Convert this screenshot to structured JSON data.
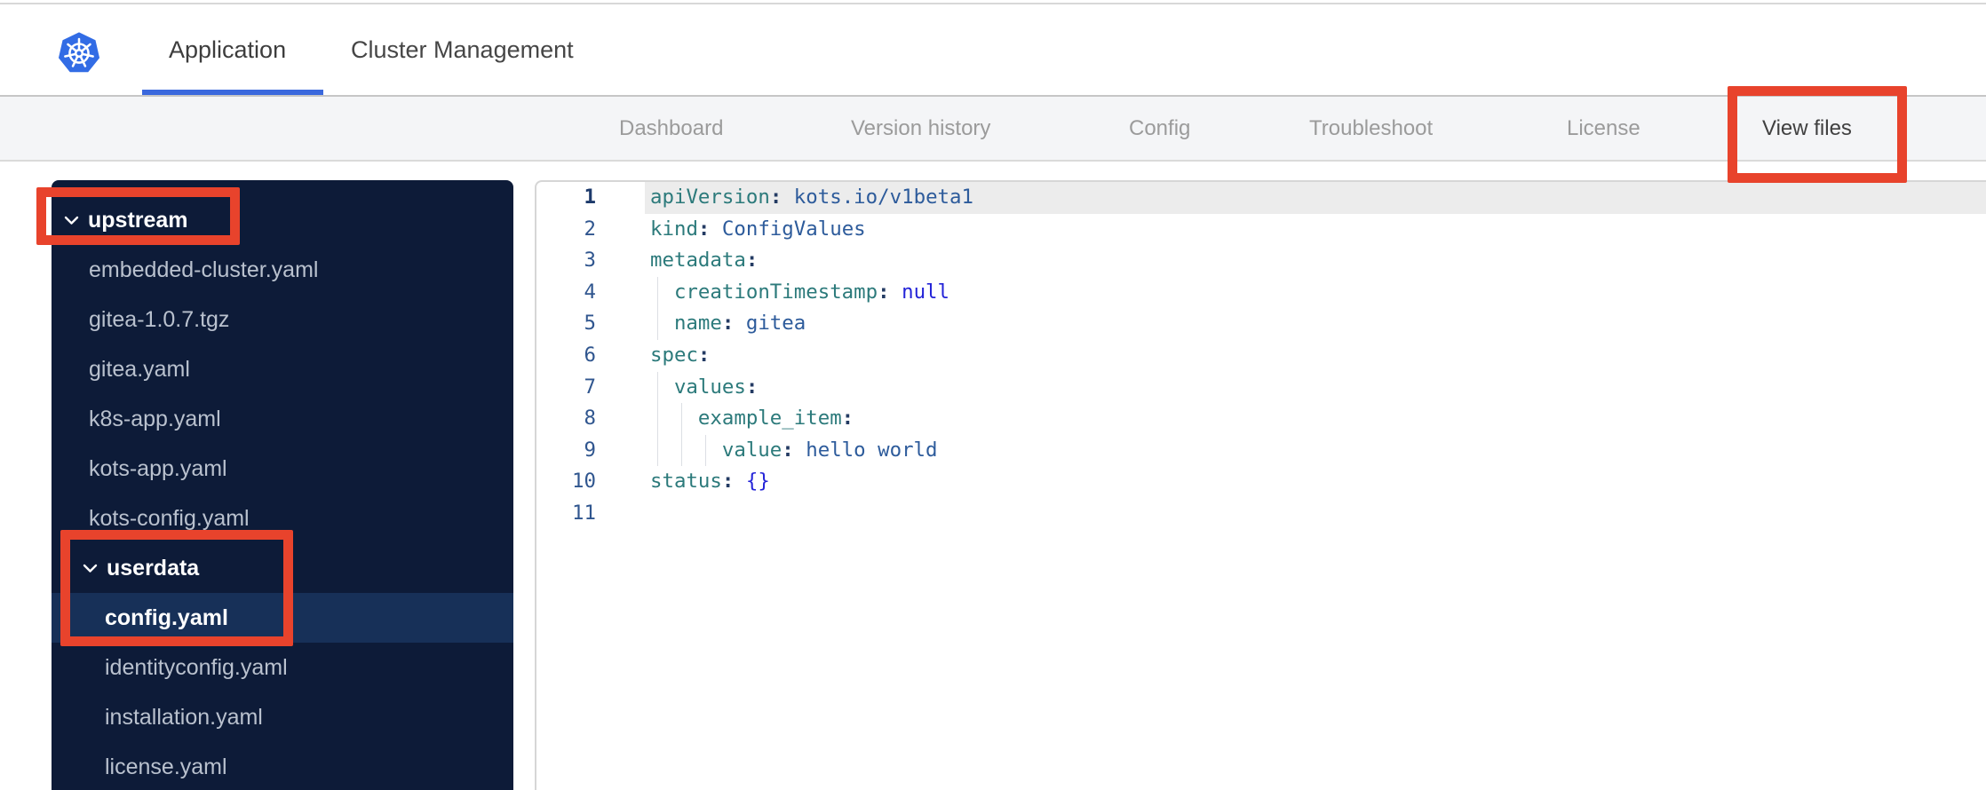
{
  "topbar": {
    "tabs": [
      {
        "label": "Application",
        "active": true
      },
      {
        "label": "Cluster Management",
        "active": false
      }
    ]
  },
  "subnav": {
    "tabs": [
      {
        "label": "Dashboard",
        "active": false
      },
      {
        "label": "Version history",
        "active": false
      },
      {
        "label": "Config",
        "active": false
      },
      {
        "label": "Troubleshoot",
        "active": false
      },
      {
        "label": "License",
        "active": false
      },
      {
        "label": "View files",
        "active": true
      }
    ]
  },
  "file_tree": {
    "items": [
      {
        "label": "upstream",
        "kind": "folder-root",
        "expanded": true,
        "selected": false
      },
      {
        "label": "embedded-cluster.yaml",
        "kind": "file-root",
        "selected": false
      },
      {
        "label": "gitea-1.0.7.tgz",
        "kind": "file-root",
        "selected": false
      },
      {
        "label": "gitea.yaml",
        "kind": "file-root",
        "selected": false
      },
      {
        "label": "k8s-app.yaml",
        "kind": "file-root",
        "selected": false
      },
      {
        "label": "kots-app.yaml",
        "kind": "file-root",
        "selected": false
      },
      {
        "label": "kots-config.yaml",
        "kind": "file-root",
        "selected": false
      },
      {
        "label": "userdata",
        "kind": "folder-sub",
        "expanded": true,
        "selected": false
      },
      {
        "label": "config.yaml",
        "kind": "file-sub",
        "selected": true
      },
      {
        "label": "identityconfig.yaml",
        "kind": "file-sub",
        "selected": false
      },
      {
        "label": "installation.yaml",
        "kind": "file-sub",
        "selected": false
      },
      {
        "label": "license.yaml",
        "kind": "file-sub",
        "selected": false
      }
    ]
  },
  "editor": {
    "language": "yaml",
    "lines": [
      {
        "num": "1",
        "active": true,
        "guides": 0,
        "tokens": [
          [
            "k",
            "apiVersion"
          ],
          [
            "p",
            ": "
          ],
          [
            "s",
            "kots.io/v1beta1"
          ]
        ]
      },
      {
        "num": "2",
        "active": false,
        "guides": 0,
        "tokens": [
          [
            "k",
            "kind"
          ],
          [
            "p",
            ": "
          ],
          [
            "s",
            "ConfigValues"
          ]
        ]
      },
      {
        "num": "3",
        "active": false,
        "guides": 0,
        "tokens": [
          [
            "k",
            "metadata"
          ],
          [
            "p",
            ":"
          ]
        ]
      },
      {
        "num": "4",
        "active": false,
        "guides": 1,
        "tokens": [
          [
            "k",
            "creationTimestamp"
          ],
          [
            "p",
            ": "
          ],
          [
            "kw",
            "null"
          ]
        ]
      },
      {
        "num": "5",
        "active": false,
        "guides": 1,
        "tokens": [
          [
            "k",
            "name"
          ],
          [
            "p",
            ": "
          ],
          [
            "s",
            "gitea"
          ]
        ]
      },
      {
        "num": "6",
        "active": false,
        "guides": 0,
        "tokens": [
          [
            "k",
            "spec"
          ],
          [
            "p",
            ":"
          ]
        ]
      },
      {
        "num": "7",
        "active": false,
        "guides": 1,
        "tokens": [
          [
            "k",
            "values"
          ],
          [
            "p",
            ":"
          ]
        ]
      },
      {
        "num": "8",
        "active": false,
        "guides": 2,
        "tokens": [
          [
            "k",
            "example_item"
          ],
          [
            "p",
            ":"
          ]
        ]
      },
      {
        "num": "9",
        "active": false,
        "guides": 3,
        "tokens": [
          [
            "k",
            "value"
          ],
          [
            "p",
            ": "
          ],
          [
            "s",
            "hello world"
          ]
        ]
      },
      {
        "num": "10",
        "active": false,
        "guides": 0,
        "tokens": [
          [
            "k",
            "status"
          ],
          [
            "p",
            ": "
          ],
          [
            "kw",
            "{}"
          ]
        ]
      },
      {
        "num": "11",
        "active": false,
        "guides": 0,
        "tokens": []
      }
    ]
  },
  "annotations": {
    "color": "#e8432c",
    "boxes": [
      "upstream-highlight",
      "userdata-config-highlight",
      "view-files-highlight"
    ]
  },
  "colors": {
    "accent_blue": "#3a68dd",
    "kubernetes_blue": "#326ce5",
    "sidebar_bg": "#0d1b38",
    "sidebar_selected_bg": "#173058",
    "annotation_red": "#e8432c"
  },
  "icons": {
    "logo": "kubernetes-helm-wheel",
    "folder_toggle": "chevron-down"
  }
}
